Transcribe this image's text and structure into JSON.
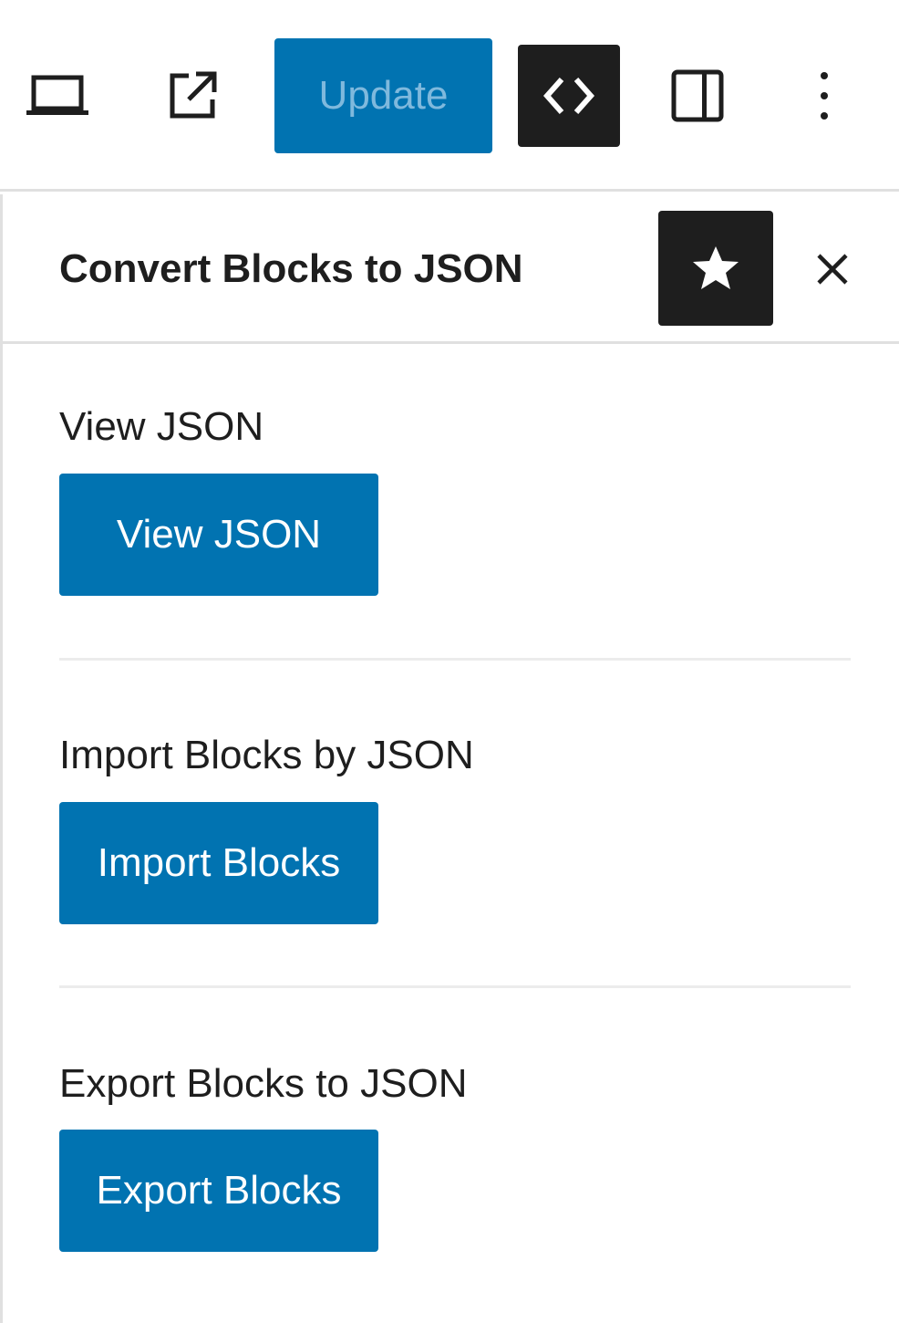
{
  "toolbar": {
    "preview_icon": "desktop-preview-icon",
    "external_icon": "external-link-icon",
    "update_label": "Update",
    "code_icon": "code-icon",
    "sidebar_icon": "sidebar-toggle-icon",
    "options_icon": "more-vertical-icon"
  },
  "panel": {
    "title": "Convert Blocks to JSON",
    "pin_icon": "star-icon",
    "close_icon": "close-icon",
    "sections": [
      {
        "label": "View JSON",
        "button": "View JSON"
      },
      {
        "label": "Import Blocks by JSON",
        "button": "Import Blocks"
      },
      {
        "label": "Export Blocks to JSON",
        "button": "Export Blocks"
      }
    ]
  },
  "colors": {
    "primary": "#0173b1",
    "primary_disabled_text": "#7fb9dd",
    "dark": "#1e1e1e",
    "border": "#e0e0e0"
  }
}
